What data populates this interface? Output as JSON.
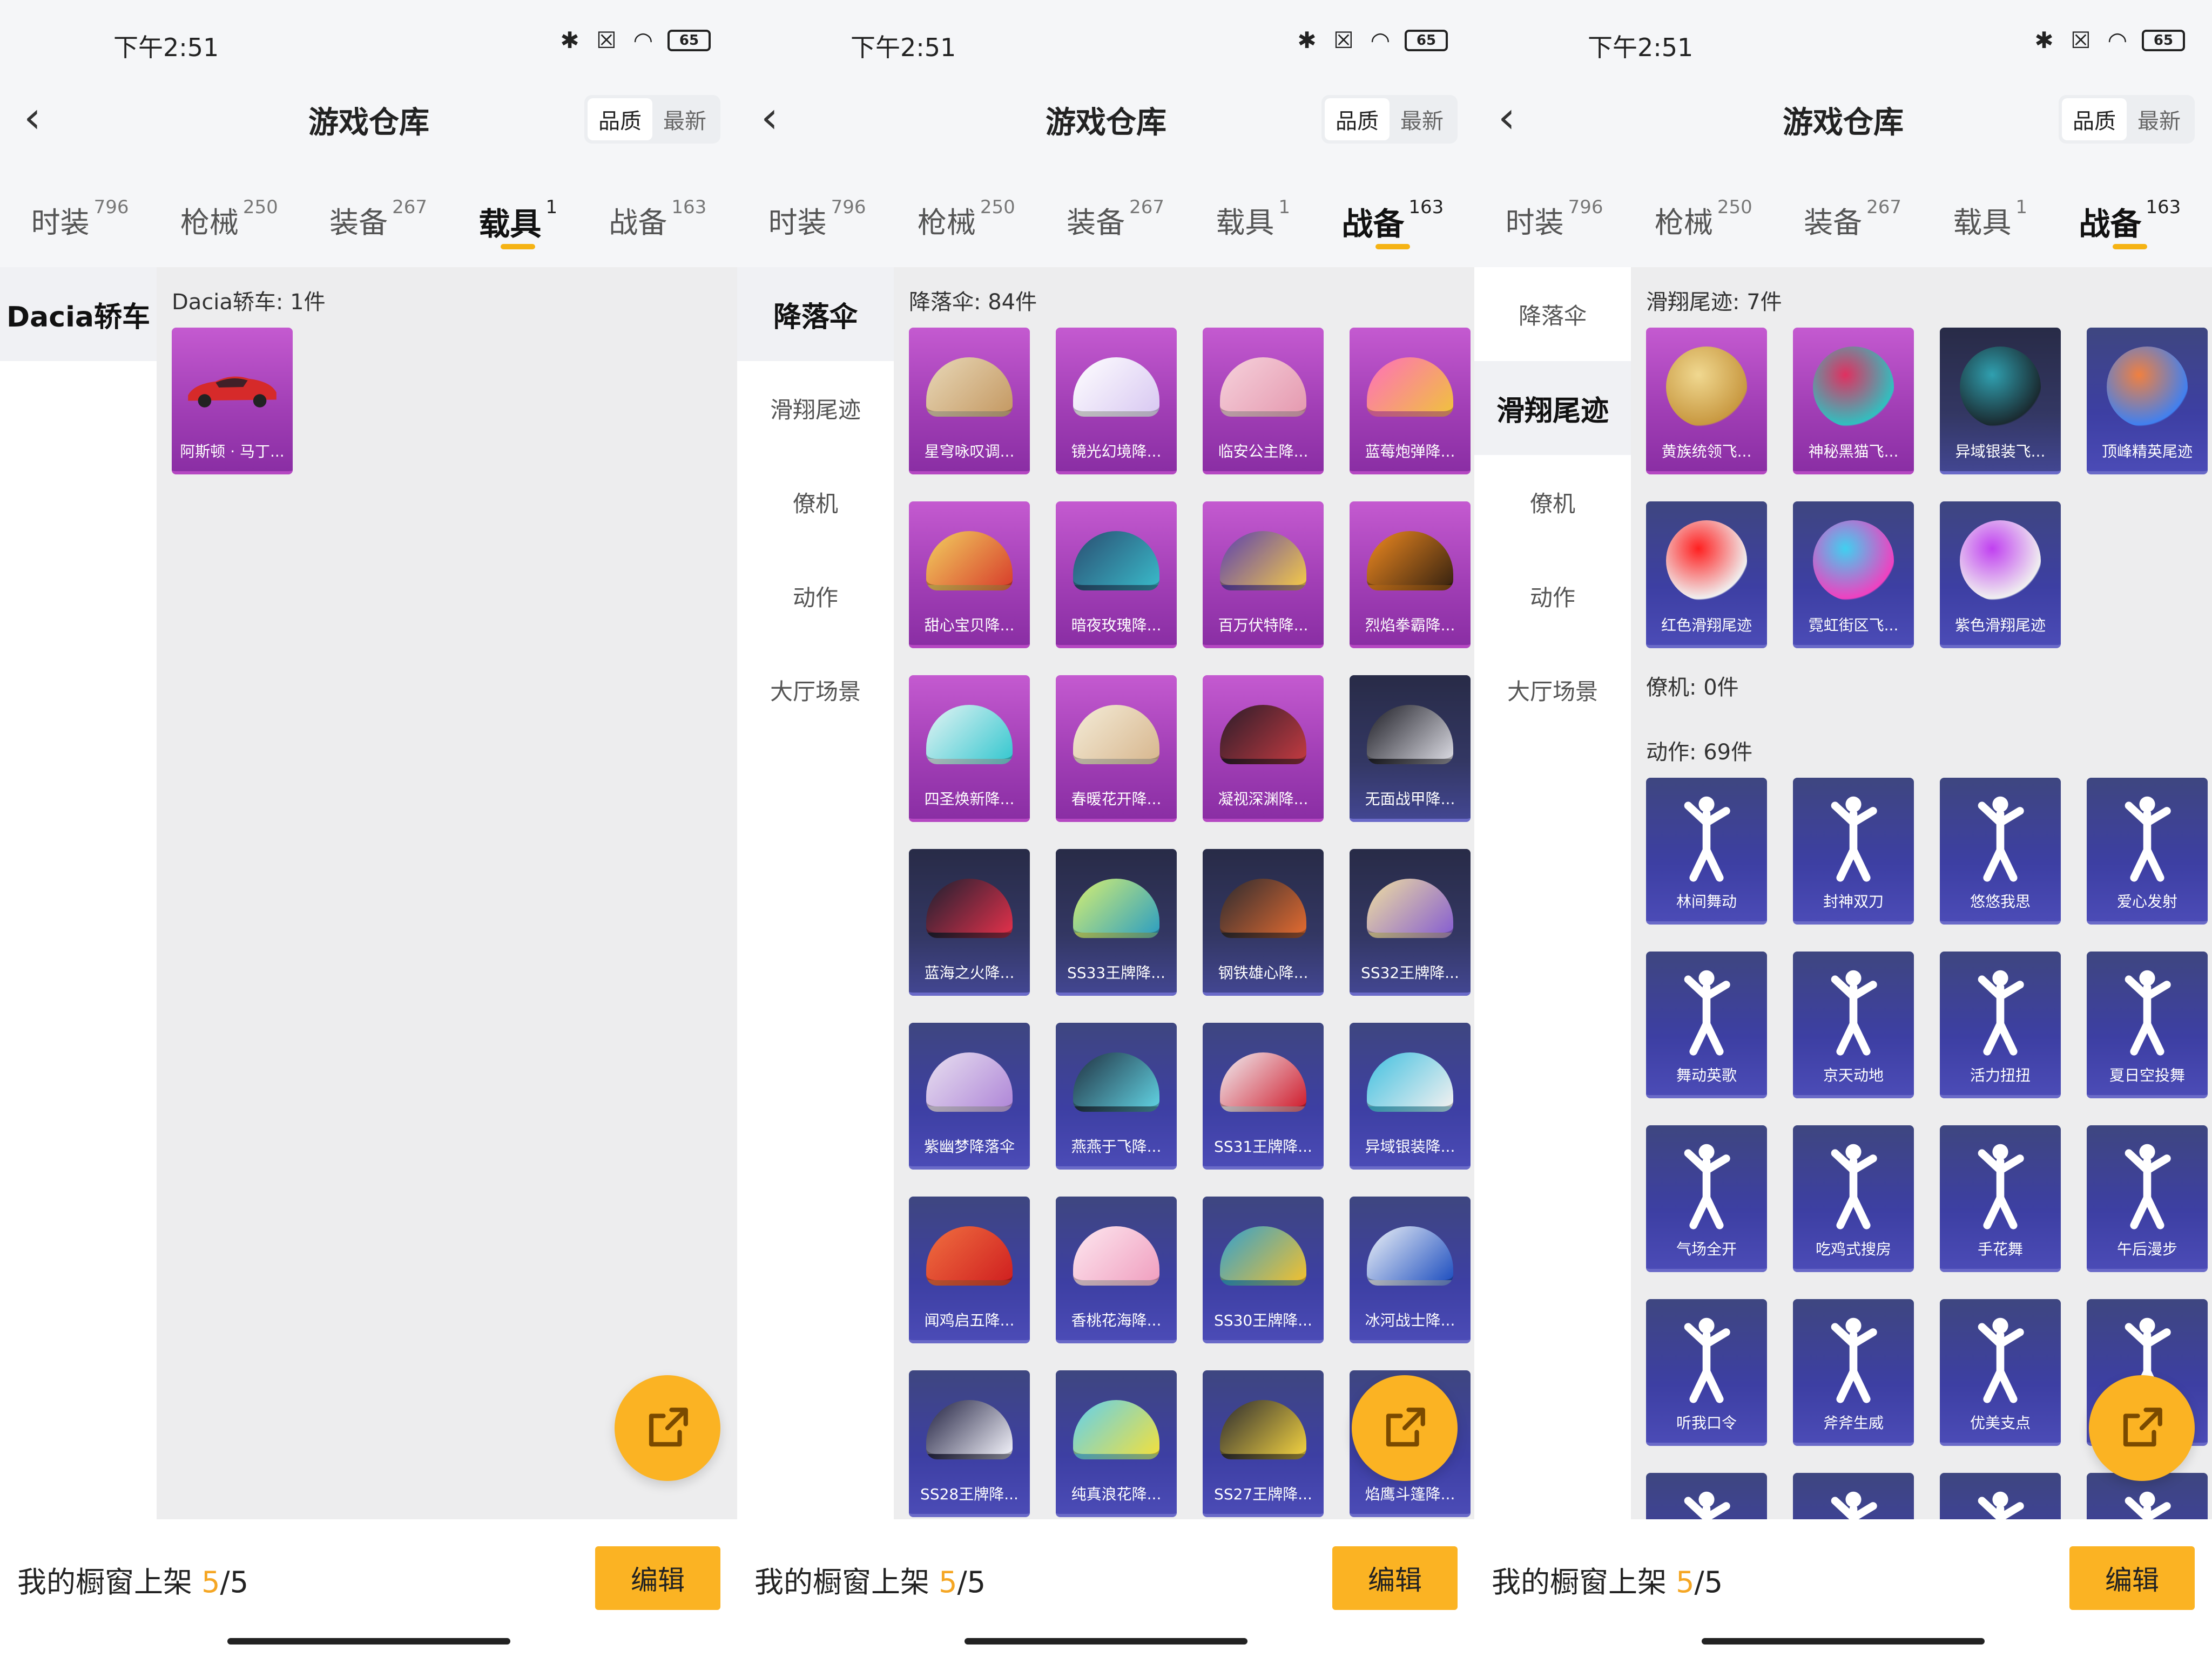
{
  "status": {
    "time": "下午2:51",
    "battery": "65"
  },
  "header": {
    "title": "游戏仓库",
    "sort_quality": "品质",
    "sort_latest": "最新"
  },
  "tabs": [
    {
      "label": "时装",
      "count": "796"
    },
    {
      "label": "枪械",
      "count": "250"
    },
    {
      "label": "装备",
      "count": "267"
    },
    {
      "label": "载具",
      "count": "1"
    },
    {
      "label": "战备",
      "count": "163"
    }
  ],
  "footer": {
    "label": "我的橱窗上架",
    "current": "5",
    "total": "/5",
    "edit": "编辑"
  },
  "colors": {
    "accent": "#fbb323",
    "epic": "#a23fb6",
    "rare": "#3d3fa3"
  },
  "phones": [
    {
      "active_tab": 3,
      "sidebar": [
        {
          "label": "Dacia轿车",
          "active": true
        }
      ],
      "sections": [
        {
          "title": "Dacia轿车: 1件",
          "items": [
            {
              "name": "阿斯顿 · 马丁...",
              "tier": "epic",
              "art": "car"
            }
          ]
        }
      ]
    },
    {
      "active_tab": 4,
      "sidebar": [
        {
          "label": "降落伞",
          "active": true
        },
        {
          "label": "滑翔尾迹",
          "active": false
        },
        {
          "label": "僚机",
          "active": false
        },
        {
          "label": "动作",
          "active": false
        },
        {
          "label": "大厅场景",
          "active": false
        }
      ],
      "sections": [
        {
          "title": "降落伞: 84件",
          "items": [
            {
              "name": "星穹咏叹调...",
              "tier": "epic",
              "art": "chute",
              "c1": "#e8d8b8",
              "c2": "#c59a64"
            },
            {
              "name": "镜光幻境降...",
              "tier": "epic",
              "art": "chute",
              "c1": "#ffffff",
              "c2": "#d9c9f2"
            },
            {
              "name": "临安公主降...",
              "tier": "epic",
              "art": "chute",
              "c1": "#f6d2dc",
              "c2": "#e59ab0"
            },
            {
              "name": "蓝莓炮弹降...",
              "tier": "epic",
              "art": "chute",
              "c1": "#ff6fbc",
              "c2": "#f0c040"
            },
            {
              "name": "甜心宝贝降...",
              "tier": "epic",
              "art": "chute",
              "c1": "#f2d060",
              "c2": "#d8402c"
            },
            {
              "name": "暗夜玫瑰降...",
              "tier": "epic",
              "art": "chute",
              "c1": "#2a4c70",
              "c2": "#39b8c8"
            },
            {
              "name": "百万伏特降...",
              "tier": "epic",
              "art": "chute",
              "c1": "#5a3fb0",
              "c2": "#f2c84a"
            },
            {
              "name": "烈焰拳霸降...",
              "tier": "epic",
              "art": "chute",
              "c1": "#f08a20",
              "c2": "#3a2410"
            },
            {
              "name": "四圣焕新降...",
              "tier": "epic",
              "art": "chute",
              "c1": "#e6f4f4",
              "c2": "#38c8d0"
            },
            {
              "name": "春暖花开降...",
              "tier": "epic",
              "art": "chute",
              "c1": "#f4ecd8",
              "c2": "#d8b890"
            },
            {
              "name": "凝视深渊降...",
              "tier": "epic",
              "art": "chute",
              "c1": "#2a1c2a",
              "c2": "#c03a40"
            },
            {
              "name": "无面战甲降...",
              "tier": "legend",
              "art": "chute",
              "c1": "#1c1c24",
              "c2": "#d8d8e0"
            },
            {
              "name": "蓝海之火降...",
              "tier": "legend",
              "art": "chute",
              "c1": "#1a2030",
              "c2": "#e0304a"
            },
            {
              "name": "SS33王牌降...",
              "tier": "legend",
              "art": "chute",
              "c1": "#d8f070",
              "c2": "#30a0c0"
            },
            {
              "name": "钢铁雄心降...",
              "tier": "legend",
              "art": "chute",
              "c1": "#2a2a30",
              "c2": "#e06a30"
            },
            {
              "name": "SS32王牌降...",
              "tier": "legend",
              "art": "chute",
              "c1": "#f0e0a0",
              "c2": "#8860d0"
            },
            {
              "name": "紫幽梦降落伞",
              "tier": "rare",
              "art": "chute",
              "c1": "#e8e0f0",
              "c2": "#b088d8"
            },
            {
              "name": "燕燕于飞降...",
              "tier": "rare",
              "art": "chute",
              "c1": "#203040",
              "c2": "#60d0e0"
            },
            {
              "name": "SS31王牌降...",
              "tier": "rare",
              "art": "chute",
              "c1": "#f0f0f4",
              "c2": "#d02030"
            },
            {
              "name": "异域银装降...",
              "tier": "rare",
              "art": "chute",
              "c1": "#40c0e0",
              "c2": "#f0f0f0"
            },
            {
              "name": "闻鸡启五降...",
              "tier": "rare",
              "art": "chute",
              "c1": "#f07040",
              "c2": "#d02020"
            },
            {
              "name": "香桃花海降...",
              "tier": "rare",
              "art": "chute",
              "c1": "#fde8f0",
              "c2": "#f0a0c0"
            },
            {
              "name": "SS30王牌降...",
              "tier": "rare",
              "art": "chute",
              "c1": "#30a0d0",
              "c2": "#f0c030"
            },
            {
              "name": "冰河战士降...",
              "tier": "rare",
              "art": "chute",
              "c1": "#f0f4f8",
              "c2": "#2050c0"
            },
            {
              "name": "SS28王牌降...",
              "tier": "rare",
              "art": "chute",
              "c1": "#202040",
              "c2": "#f0f0f8"
            },
            {
              "name": "纯真浪花降...",
              "tier": "rare",
              "art": "chute",
              "c1": "#60d0f0",
              "c2": "#f0e040"
            },
            {
              "name": "SS27王牌降...",
              "tier": "rare",
              "art": "chute",
              "c1": "#2a2a30",
              "c2": "#f0d040"
            },
            {
              "name": "焰鹰斗篷降...",
              "tier": "rare",
              "art": "chute",
              "c1": "#404048",
              "c2": "#c0c0c8"
            }
          ]
        }
      ]
    },
    {
      "active_tab": 4,
      "sidebar": [
        {
          "label": "降落伞",
          "active": false
        },
        {
          "label": "滑翔尾迹",
          "active": true
        },
        {
          "label": "僚机",
          "active": false
        },
        {
          "label": "动作",
          "active": false
        },
        {
          "label": "大厅场景",
          "active": false
        }
      ],
      "sections": [
        {
          "title": "滑翔尾迹: 7件",
          "items": [
            {
              "name": "黄族统领飞...",
              "tier": "epic",
              "art": "orb",
              "c1": "#f0d890",
              "c2": "#c89840"
            },
            {
              "name": "神秘黑猫飞...",
              "tier": "epic",
              "art": "orb",
              "c1": "#e03060",
              "c2": "#30c0c0"
            },
            {
              "name": "异域银装飞...",
              "tier": "legend",
              "art": "orb",
              "c1": "#30a0b0",
              "c2": "#1a2a30"
            },
            {
              "name": "顶峰精英尾迹",
              "tier": "rare",
              "art": "orb",
              "c1": "#f08040",
              "c2": "#4080f0"
            },
            {
              "name": "红色滑翔尾迹",
              "tier": "rare",
              "art": "orb",
              "c1": "#ff2020",
              "c2": "#f0f0f0"
            },
            {
              "name": "霓虹街区飞...",
              "tier": "rare",
              "art": "orb",
              "c1": "#40d0f0",
              "c2": "#f040c0"
            },
            {
              "name": "紫色滑翔尾迹",
              "tier": "rare",
              "art": "orb",
              "c1": "#c040f0",
              "c2": "#f0f0f0"
            }
          ]
        },
        {
          "title": "僚机: 0件",
          "items": []
        },
        {
          "title": "动作: 69件",
          "items": [
            {
              "name": "林间舞动",
              "tier": "rare",
              "art": "figure"
            },
            {
              "name": "封神双刀",
              "tier": "rare",
              "art": "figure"
            },
            {
              "name": "悠悠我思",
              "tier": "rare",
              "art": "figure"
            },
            {
              "name": "爱心发射",
              "tier": "rare",
              "art": "figure"
            },
            {
              "name": "舞动英歌",
              "tier": "rare",
              "art": "figure"
            },
            {
              "name": "京天动地",
              "tier": "rare",
              "art": "figure"
            },
            {
              "name": "活力扭扭",
              "tier": "rare",
              "art": "figure"
            },
            {
              "name": "夏日空投舞",
              "tier": "rare",
              "art": "figure"
            },
            {
              "name": "气场全开",
              "tier": "rare",
              "art": "figure"
            },
            {
              "name": "吃鸡式搜房",
              "tier": "rare",
              "art": "figure"
            },
            {
              "name": "手花舞",
              "tier": "rare",
              "art": "figure"
            },
            {
              "name": "午后漫步",
              "tier": "rare",
              "art": "figure"
            },
            {
              "name": "听我口令",
              "tier": "rare",
              "art": "figure"
            },
            {
              "name": "斧斧生威",
              "tier": "rare",
              "art": "figure"
            },
            {
              "name": "优美支点",
              "tier": "rare",
              "art": "figure"
            },
            {
              "name": "",
              "tier": "rare",
              "art": "figure"
            },
            {
              "name": "",
              "tier": "rare",
              "art": "figure"
            },
            {
              "name": "",
              "tier": "rare",
              "art": "figure"
            },
            {
              "name": "",
              "tier": "rare",
              "art": "figure"
            },
            {
              "name": "",
              "tier": "rare",
              "art": "figure"
            }
          ]
        }
      ]
    }
  ]
}
